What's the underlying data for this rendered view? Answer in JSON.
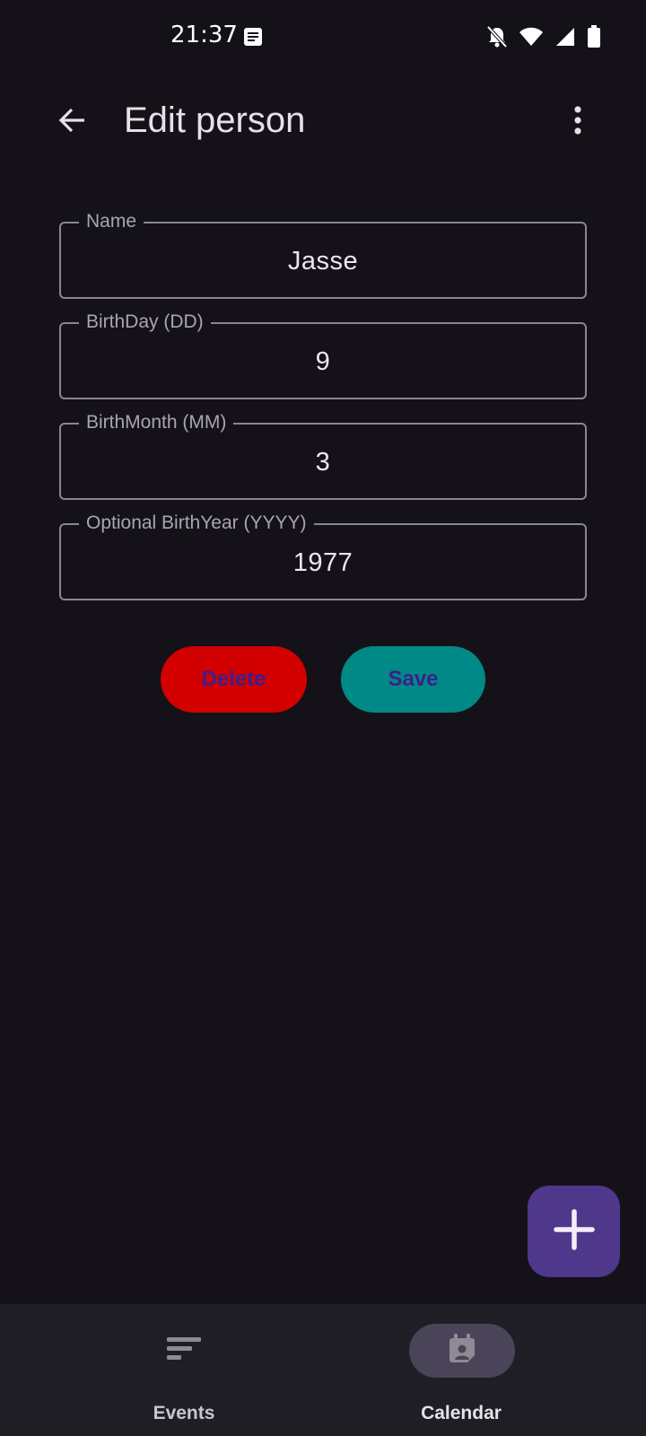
{
  "status_bar": {
    "time": "21:37",
    "icons": [
      "note-icon",
      "bell-off-icon",
      "wifi-icon",
      "signal-icon",
      "battery-icon"
    ]
  },
  "app_bar": {
    "title": "Edit person",
    "back_icon": "arrow-back-icon",
    "overflow_icon": "more-vert-icon"
  },
  "form": {
    "name": {
      "label": "Name",
      "value": "Jasse"
    },
    "birth_day": {
      "label": "BirthDay (DD)",
      "value": "9"
    },
    "birth_month": {
      "label": "BirthMonth (MM)",
      "value": "3"
    },
    "birth_year": {
      "label": "Optional BirthYear (YYYY)",
      "value": "1977"
    }
  },
  "actions": {
    "delete_label": "Delete",
    "save_label": "Save"
  },
  "fab": {
    "icon": "add-icon"
  },
  "bottom_nav": {
    "items": [
      {
        "label": "Events",
        "icon": "events-list-icon",
        "selected": false
      },
      {
        "label": "Calendar",
        "icon": "calendar-person-icon",
        "selected": true
      }
    ]
  },
  "colors": {
    "background": "#141218",
    "delete": "#d30000",
    "save": "#008986",
    "button_text": "#3c1f8c",
    "fab": "#4f378b",
    "nav_bg": "#1f1e24",
    "nav_indicator": "#4a4458"
  }
}
